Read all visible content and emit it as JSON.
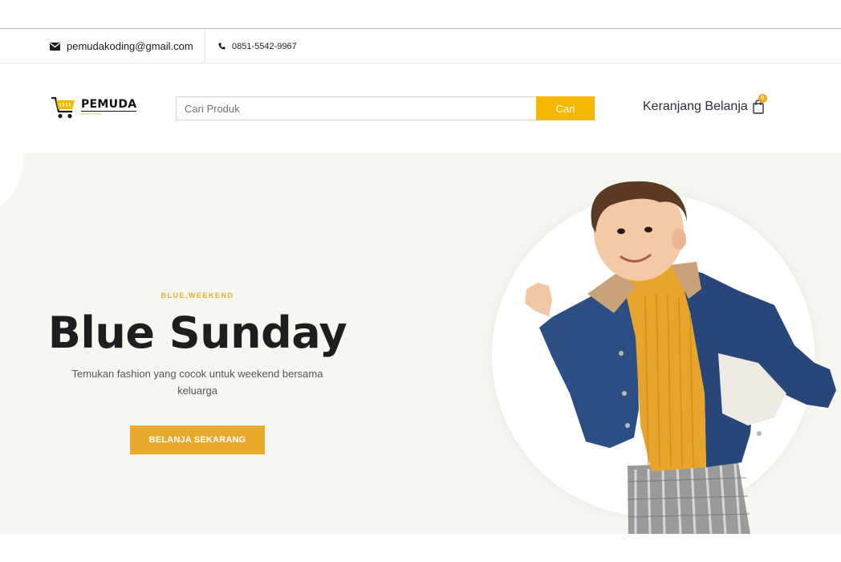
{
  "topbar": {
    "email": "pemudakoding@gmail.com",
    "phone": "0851-5542-9967",
    "email_icon": "envelope-icon",
    "phone_icon": "phone-icon"
  },
  "header": {
    "logo_title": "PEMUDA",
    "logo_subtitle": "Milenial Shop",
    "search_placeholder": "Cari Produk",
    "search_button": "Cari",
    "cart_label": "Keranjang Belanja",
    "cart_count": "0",
    "cart_icon": "shopping-bag-icon"
  },
  "hero": {
    "tag": "BLUE,WEEKEND",
    "title": "Blue Sunday",
    "description": "Temukan fashion yang cocok untuk weekend bersama keluarga",
    "cta": "BELANJA SEKARANG"
  },
  "colors": {
    "accent": "#e8a92c",
    "search_button": "#f5b800",
    "hero_bg": "#f7f7f2"
  }
}
